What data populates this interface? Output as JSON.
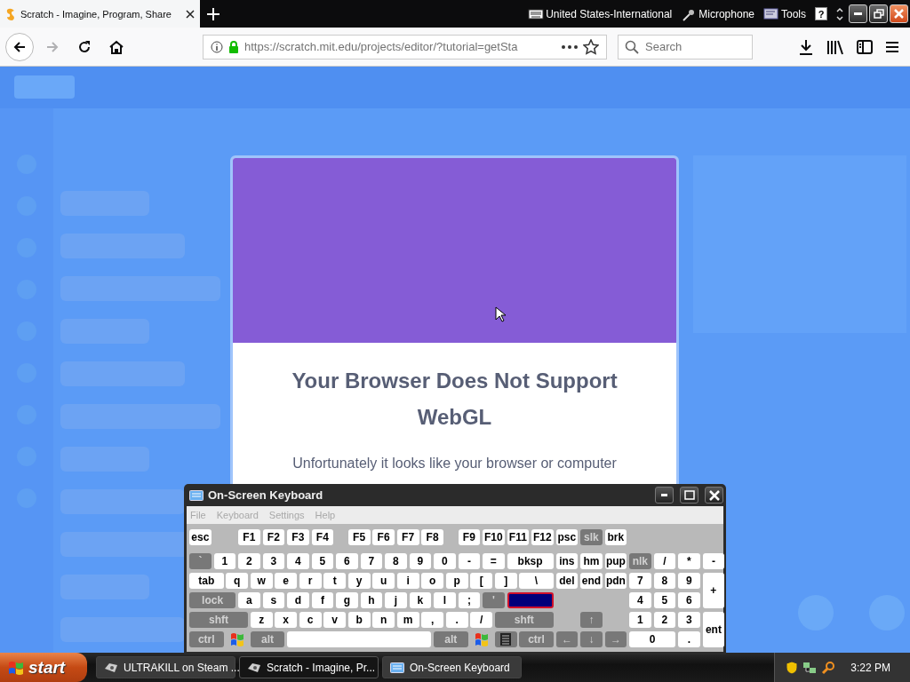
{
  "browser": {
    "tab": {
      "title": "Scratch - Imagine, Program, Share",
      "selected": true
    },
    "language_bar": [
      {
        "kind": "keyboard",
        "label": "United States-International"
      },
      {
        "kind": "microphone",
        "label": "Microphone"
      },
      {
        "kind": "tools",
        "label": "Tools"
      },
      {
        "kind": "help",
        "label": "?"
      }
    ],
    "nav_buttons": [
      {
        "kind": "back",
        "disabled": false
      },
      {
        "kind": "forward",
        "disabled": true
      },
      {
        "kind": "reload",
        "disabled": false
      },
      {
        "kind": "home",
        "disabled": false
      }
    ],
    "address": {
      "url": "https://scratch.mit.edu/projects/editor/?tutorial=getSta",
      "secure": true
    },
    "search": {
      "placeholder": "Search"
    }
  },
  "dialog": {
    "title": "Your Browser Does Not Support WebGL",
    "message": "Unfortunately it looks like your browser or computer"
  },
  "keyboard_window": {
    "title": "On-Screen Keyboard",
    "menu": [
      {
        "label": "File",
        "disabled": true
      },
      {
        "label": "Keyboard",
        "disabled": true
      },
      {
        "label": "Settings",
        "disabled": true
      },
      {
        "label": "Help",
        "disabled": true
      }
    ],
    "keys": [
      {
        "label": "esc",
        "kind": "key"
      },
      {
        "label": "F1",
        "kind": "key"
      },
      {
        "label": "F2",
        "kind": "key"
      },
      {
        "label": "F3",
        "kind": "key"
      },
      {
        "label": "F4",
        "kind": "key"
      },
      {
        "label": "F5",
        "kind": "key"
      },
      {
        "label": "F6",
        "kind": "key"
      },
      {
        "label": "F7",
        "kind": "key"
      },
      {
        "label": "F8",
        "kind": "key"
      },
      {
        "label": "F9",
        "kind": "key"
      },
      {
        "label": "F10",
        "kind": "key"
      },
      {
        "label": "F11",
        "kind": "key"
      },
      {
        "label": "F12",
        "kind": "key"
      },
      {
        "label": "psc",
        "kind": "key"
      },
      {
        "label": "slk",
        "kind": "modifier"
      },
      {
        "label": "brk",
        "kind": "key"
      },
      {
        "label": "`",
        "kind": "modifier"
      },
      {
        "label": "1",
        "kind": "key"
      },
      {
        "label": "2",
        "kind": "key"
      },
      {
        "label": "3",
        "kind": "key"
      },
      {
        "label": "4",
        "kind": "key"
      },
      {
        "label": "5",
        "kind": "key"
      },
      {
        "label": "6",
        "kind": "key"
      },
      {
        "label": "7",
        "kind": "key"
      },
      {
        "label": "8",
        "kind": "key"
      },
      {
        "label": "9",
        "kind": "key"
      },
      {
        "label": "0",
        "kind": "key"
      },
      {
        "label": "-",
        "kind": "key"
      },
      {
        "label": "=",
        "kind": "key"
      },
      {
        "label": "bksp",
        "kind": "key"
      },
      {
        "label": "ins",
        "kind": "key"
      },
      {
        "label": "hm",
        "kind": "key"
      },
      {
        "label": "pup",
        "kind": "key"
      },
      {
        "label": "nlk",
        "kind": "modifier"
      },
      {
        "label": "/",
        "kind": "key"
      },
      {
        "label": "*",
        "kind": "key"
      },
      {
        "label": "-",
        "kind": "key"
      },
      {
        "label": "tab",
        "kind": "key"
      },
      {
        "label": "q",
        "kind": "key"
      },
      {
        "label": "w",
        "kind": "key"
      },
      {
        "label": "e",
        "kind": "key"
      },
      {
        "label": "r",
        "kind": "key"
      },
      {
        "label": "t",
        "kind": "key"
      },
      {
        "label": "y",
        "kind": "key"
      },
      {
        "label": "u",
        "kind": "key"
      },
      {
        "label": "i",
        "kind": "key"
      },
      {
        "label": "o",
        "kind": "key"
      },
      {
        "label": "p",
        "kind": "key"
      },
      {
        "label": "[",
        "kind": "key"
      },
      {
        "label": "]",
        "kind": "key"
      },
      {
        "label": "\\",
        "kind": "key"
      },
      {
        "label": "del",
        "kind": "key"
      },
      {
        "label": "end",
        "kind": "key"
      },
      {
        "label": "pdn",
        "kind": "key"
      },
      {
        "label": "7",
        "kind": "key"
      },
      {
        "label": "8",
        "kind": "key"
      },
      {
        "label": "9",
        "kind": "key"
      },
      {
        "label": "+",
        "kind": "key"
      },
      {
        "label": "lock",
        "kind": "modifier"
      },
      {
        "label": "a",
        "kind": "key"
      },
      {
        "label": "s",
        "kind": "key"
      },
      {
        "label": "d",
        "kind": "key"
      },
      {
        "label": "f",
        "kind": "key"
      },
      {
        "label": "g",
        "kind": "key"
      },
      {
        "label": "h",
        "kind": "key"
      },
      {
        "label": "j",
        "kind": "key"
      },
      {
        "label": "k",
        "kind": "key"
      },
      {
        "label": "l",
        "kind": "key"
      },
      {
        "label": ";",
        "kind": "key"
      },
      {
        "label": "'",
        "kind": "modifier"
      },
      {
        "kind": "highlighted"
      },
      {
        "label": "4",
        "kind": "key"
      },
      {
        "label": "5",
        "kind": "key"
      },
      {
        "label": "6",
        "kind": "key"
      },
      {
        "label": "shft",
        "kind": "modifier"
      },
      {
        "label": "z",
        "kind": "key"
      },
      {
        "label": "x",
        "kind": "key"
      },
      {
        "label": "c",
        "kind": "key"
      },
      {
        "label": "v",
        "kind": "key"
      },
      {
        "label": "b",
        "kind": "key"
      },
      {
        "label": "n",
        "kind": "key"
      },
      {
        "label": "m",
        "kind": "key"
      },
      {
        "label": ",",
        "kind": "key"
      },
      {
        "label": ".",
        "kind": "key"
      },
      {
        "label": "/",
        "kind": "key"
      },
      {
        "label": "shft",
        "kind": "modifier"
      },
      {
        "label": "↑",
        "kind": "modifier"
      },
      {
        "label": "1",
        "kind": "key"
      },
      {
        "label": "2",
        "kind": "key"
      },
      {
        "label": "3",
        "kind": "key"
      },
      {
        "label": "ent",
        "kind": "key"
      },
      {
        "label": "ctrl",
        "kind": "modifier"
      },
      {
        "kind": "windows"
      },
      {
        "label": "alt",
        "kind": "modifier"
      },
      {
        "kind": "space"
      },
      {
        "label": "alt",
        "kind": "modifier"
      },
      {
        "kind": "windows"
      },
      {
        "kind": "menu"
      },
      {
        "label": "ctrl",
        "kind": "modifier"
      },
      {
        "label": "←",
        "kind": "modifier"
      },
      {
        "label": "↓",
        "kind": "modifier"
      },
      {
        "label": "→",
        "kind": "modifier"
      },
      {
        "label": "0",
        "kind": "key"
      },
      {
        "label": ".",
        "kind": "key"
      }
    ]
  },
  "taskbar": {
    "start": "start",
    "tasks": [
      {
        "kind": "game",
        "label": "ULTRAKILL on Steam ...",
        "selected": false
      },
      {
        "kind": "browser",
        "label": "Scratch - Imagine, Pr...",
        "selected": true
      },
      {
        "kind": "keyboard",
        "label": "On-Screen Keyboard",
        "selected": false
      }
    ],
    "clock": "3:22 PM"
  }
}
